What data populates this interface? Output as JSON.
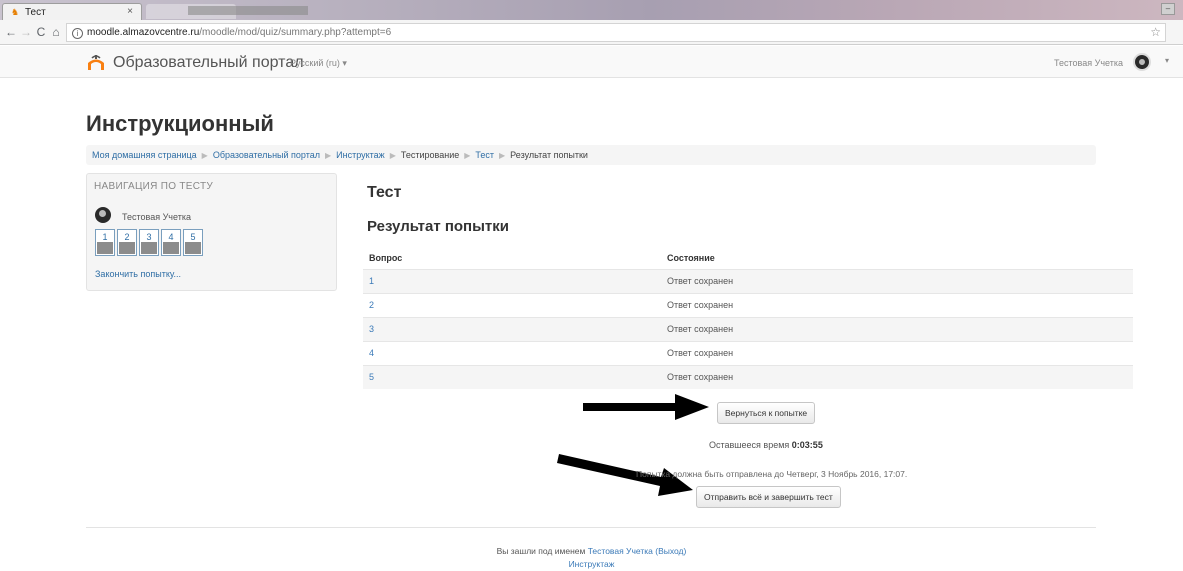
{
  "browser": {
    "tab_title": "Тест",
    "tab_close": "×",
    "url_host": "moodle.almazovcentre.ru",
    "url_path": "/moodle/mod/quiz/summary.php?attempt=6",
    "back": "←",
    "forward": "→",
    "reload": "C",
    "home": "⌂",
    "info": "i",
    "star": "☆",
    "minimize": "–"
  },
  "navbar": {
    "brand": "Образовательный портал",
    "language": "Русский (ru) ▾",
    "user_name": "Тестовая Учетка",
    "caret": "▾"
  },
  "page": {
    "heading": "Инструкционный",
    "breadcrumb": [
      "Моя домашняя страница",
      "Образовательный портал",
      "Инструктаж",
      "Тестирование",
      "Тест",
      "Результат попытки"
    ],
    "breadcrumb_sep": "▶"
  },
  "quiz_nav": {
    "title": "НАВИГАЦИЯ ПО ТЕСТУ",
    "user": "Тестовая Учетка",
    "questions": [
      "1",
      "2",
      "3",
      "4",
      "5"
    ],
    "finish_link": "Закончить попытку..."
  },
  "main": {
    "quiz_title": "Тест",
    "summary_title": "Результат попытки",
    "table_headers": [
      "Вопрос",
      "Состояние"
    ],
    "rows": [
      {
        "q": "1",
        "state": "Ответ сохранен"
      },
      {
        "q": "2",
        "state": "Ответ сохранен"
      },
      {
        "q": "3",
        "state": "Ответ сохранен"
      },
      {
        "q": "4",
        "state": "Ответ сохранен"
      },
      {
        "q": "5",
        "state": "Ответ сохранен"
      }
    ],
    "return_button": "Вернуться к попытке",
    "time_left_label": "Оставшееся время",
    "time_left_value": "0:03:55",
    "due_text": "Попытка должна быть отправлена до Четверг, 3 Ноябрь 2016, 17:07.",
    "submit_button": "Отправить всё и завершить тест"
  },
  "footer": {
    "logged_in_prefix": "Вы зашли под именем",
    "logged_in_user": "Тестовая Учетка",
    "logout": "(Выход)",
    "home": "Инструктаж"
  }
}
